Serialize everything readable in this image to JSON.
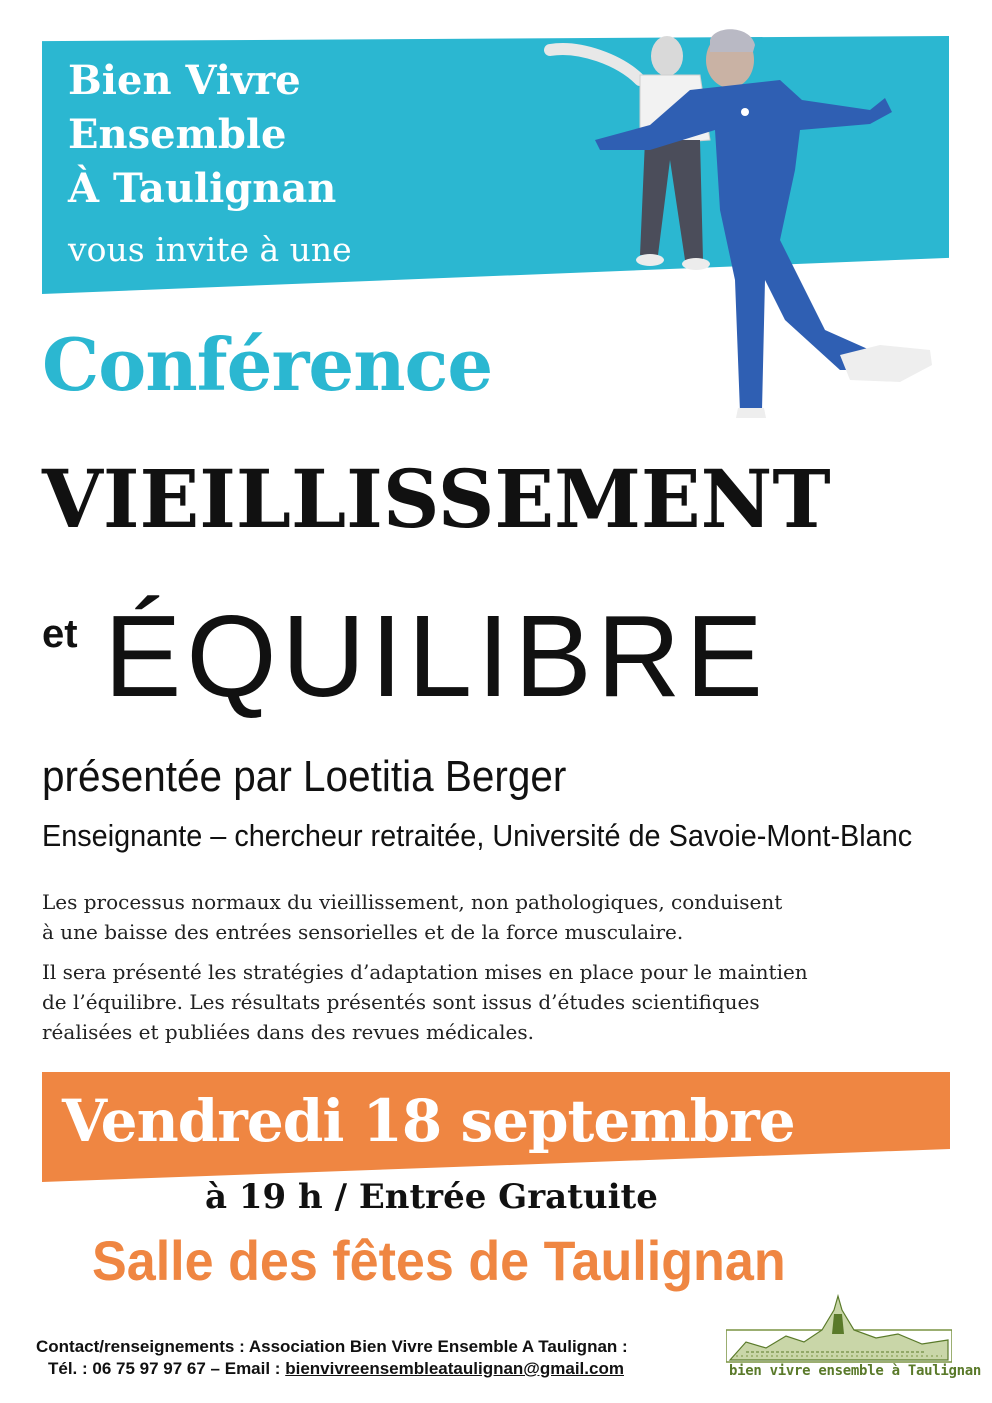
{
  "header": {
    "org_line1": "Bien Vivre",
    "org_line2": "Ensemble",
    "org_line3": "À Taulignan",
    "invite": "vous invite à une"
  },
  "event": {
    "type": "Conférence",
    "title_main": "VIEILLISSEMENT",
    "title_et": "et",
    "title_second": "ÉQUILIBRE",
    "presenter": "présentée par Loetitia Berger",
    "role": "Enseignante – chercheur retraitée, Université de Savoie-Mont-Blanc"
  },
  "description": {
    "p1_line1": "Les processus normaux du vieillissement, non pathologiques, conduisent",
    "p1_line2": "à une baisse des entrées sensorielles et de la force musculaire.",
    "p2_line1": "Il sera présenté les stratégies d’adaptation mises en place pour le maintien",
    "p2_line2": "de l’équilibre. Les résultats présentés sont issus d’études scientifiques",
    "p2_line3": "réalisées et publiées dans des revues médicales."
  },
  "schedule": {
    "date": "Vendredi 18 septembre",
    "time": "à 19 h / Entrée Gratuite",
    "venue": "Salle des fêtes de Taulignan"
  },
  "contact": {
    "line1": "Contact/renseignements : Association Bien Vivre Ensemble A Taulignan :",
    "phone_prefix": "Tél. : 06 75 97 97 67 – Email :",
    "email": "bienvivreensembleataulignan@gmail.com"
  },
  "logo": {
    "text": "bien vivre ensemble à Taulignan"
  },
  "colors": {
    "blue": "#2bb7d1",
    "orange": "#ef8642",
    "logo_green": "#5a7a2a"
  }
}
